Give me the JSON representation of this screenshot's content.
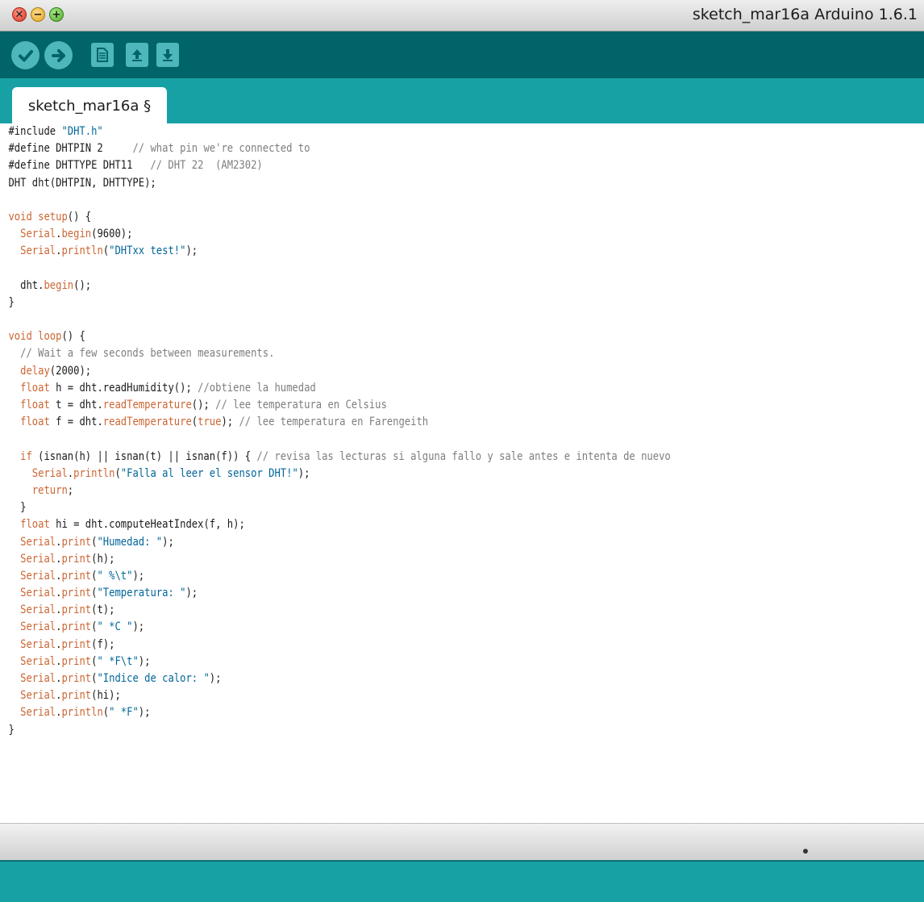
{
  "window": {
    "title": "sketch_mar16a Arduino 1.6.1"
  },
  "toolbar": {
    "buttons": [
      "verify",
      "upload",
      "new",
      "open",
      "save"
    ]
  },
  "tabs": [
    {
      "label": "sketch_mar16a §"
    }
  ],
  "editor": {
    "lines": [
      "#include \"DHT.h\"",
      "#define DHTPIN 2     // what pin we're connected to",
      "#define DHTTYPE DHT11   // DHT 22  (AM2302)",
      "DHT dht(DHTPIN, DHTTYPE);",
      "",
      "void setup() {",
      "  Serial.begin(9600);",
      "  Serial.println(\"DHTxx test!\");",
      "",
      "  dht.begin();",
      "}",
      "",
      "void loop() {",
      "  // Wait a few seconds between measurements.",
      "  delay(2000);",
      "  float h = dht.readHumidity(); //obtiene la humedad",
      "  float t = dht.readTemperature(); // lee temperatura en Celsius",
      "  float f = dht.readTemperature(true); // lee temperatura en Farengeith",
      "",
      "  if (isnan(h) || isnan(t) || isnan(f)) { // revisa las lecturas si alguna fallo y sale antes e intenta de nuevo",
      "    Serial.println(\"Falla al leer el sensor DHT!\");",
      "    return;",
      "  }",
      "  float hi = dht.computeHeatIndex(f, h);",
      "  Serial.print(\"Humedad: \");",
      "  Serial.print(h);",
      "  Serial.print(\" %\\t\");",
      "  Serial.print(\"Temperatura: \");",
      "  Serial.print(t);",
      "  Serial.print(\" *C \");",
      "  Serial.print(f);",
      "  Serial.print(\" *F\\t\");",
      "  Serial.print(\"Indice de calor: \");",
      "  Serial.print(hi);",
      "  Serial.println(\" *F\");",
      "}"
    ]
  }
}
